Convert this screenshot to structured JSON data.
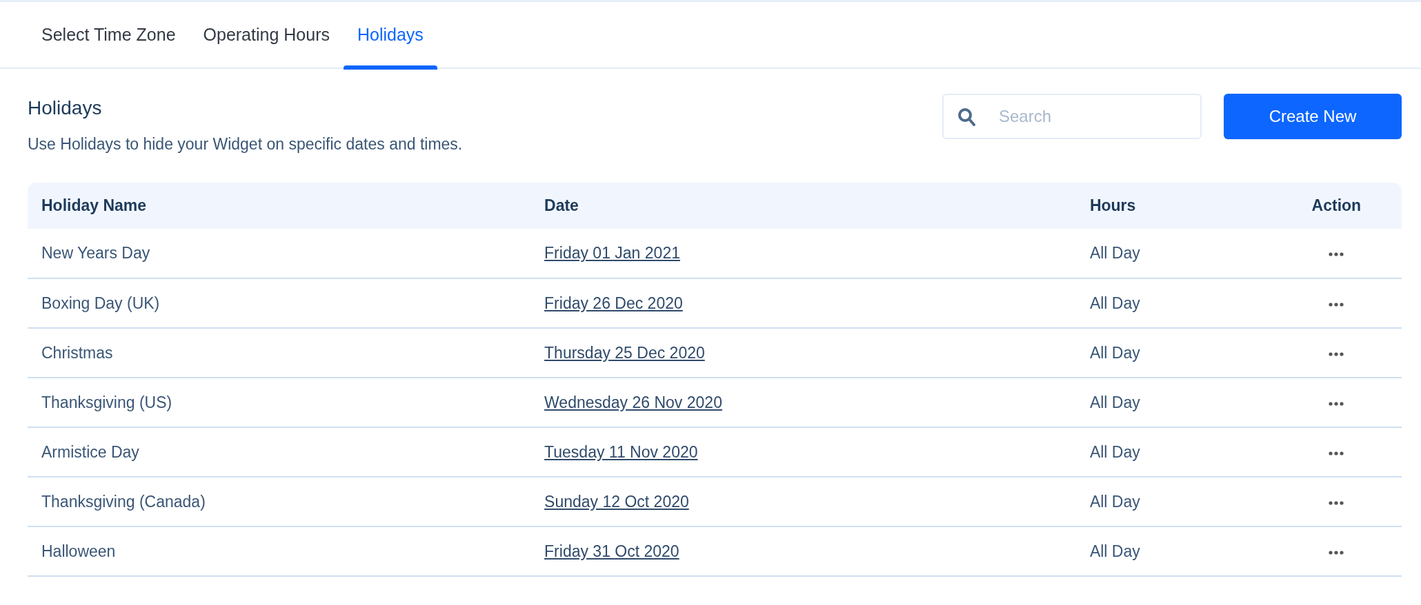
{
  "tabs": [
    {
      "label": "Select Time Zone",
      "selected": false
    },
    {
      "label": "Operating Hours",
      "selected": false
    },
    {
      "label": "Holidays",
      "selected": true
    }
  ],
  "section": {
    "title": "Holidays",
    "description": "Use Holidays to hide your Widget on specific dates and times."
  },
  "search": {
    "placeholder": "Search"
  },
  "create_button": "Create New",
  "table": {
    "columns": [
      "Holiday Name",
      "Date",
      "Hours",
      "Action"
    ],
    "rows": [
      {
        "name": "New Years Day",
        "date": "Friday 01 Jan 2021",
        "hours": "All Day"
      },
      {
        "name": "Boxing Day (UK)",
        "date": "Friday 26 Dec 2020",
        "hours": "All Day"
      },
      {
        "name": "Christmas",
        "date": "Thursday 25 Dec 2020",
        "hours": "All Day"
      },
      {
        "name": "Thanksgiving (US)",
        "date": "Wednesday 26 Nov 2020",
        "hours": "All Day"
      },
      {
        "name": "Armistice Day",
        "date": "Tuesday 11 Nov 2020",
        "hours": "All Day"
      },
      {
        "name": "Thanksgiving (Canada)",
        "date": "Sunday 12 Oct 2020",
        "hours": "All Day"
      },
      {
        "name": "Halloween",
        "date": "Friday 31 Oct 2020",
        "hours": "All Day"
      }
    ]
  }
}
